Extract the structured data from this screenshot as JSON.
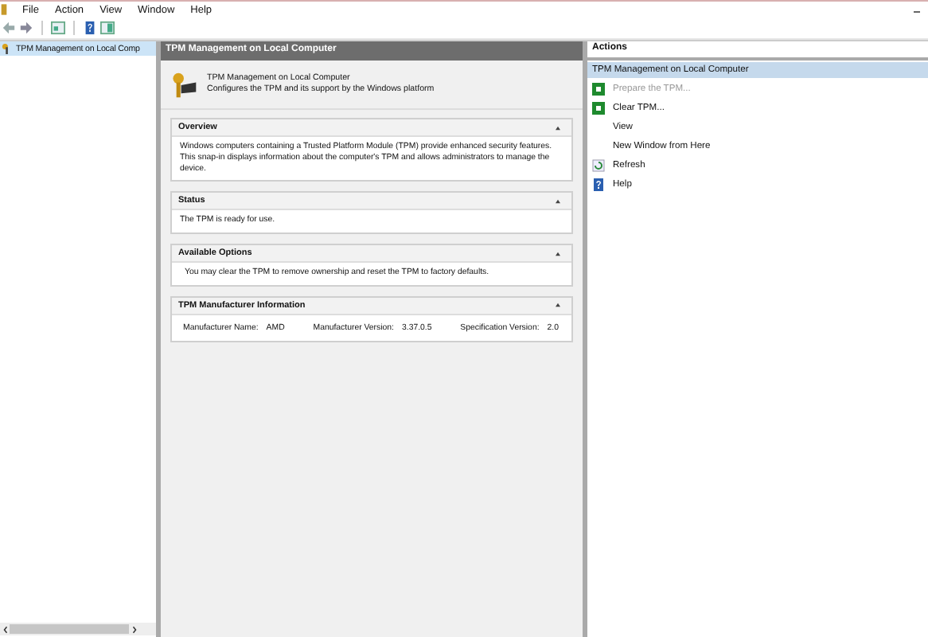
{
  "menu": [
    "File",
    "Action",
    "View",
    "Window",
    "Help"
  ],
  "tree": {
    "items": [
      {
        "label": "TPM Management on Local Comp",
        "selected": true
      }
    ]
  },
  "center": {
    "title": "TPM Management on Local Computer",
    "header": {
      "title": "TPM Management on Local Computer",
      "subtitle": "Configures the TPM and its support by the Windows platform"
    },
    "sections": [
      {
        "title": "Overview",
        "kind": "text",
        "text": "Windows computers containing a Trusted Platform Module (TPM) provide enhanced security features. This snap-in displays information about the computer's TPM and allows administrators to manage the device."
      },
      {
        "title": "Status",
        "kind": "text",
        "text": "The TPM is ready for use."
      },
      {
        "title": "Available Options",
        "kind": "text",
        "text": "You may clear the TPM to remove ownership and reset the TPM to factory defaults."
      },
      {
        "title": "TPM Manufacturer Information",
        "kind": "fields",
        "fields": [
          {
            "label": "Manufacturer Name:",
            "value": "AMD"
          },
          {
            "label": "Manufacturer Version:",
            "value": "3.37.0.5"
          },
          {
            "label": "Specification Version:",
            "value": "2.0"
          }
        ]
      }
    ]
  },
  "actions": {
    "title": "Actions",
    "group": "TPM Management on Local Computer",
    "items": [
      {
        "label": "Prepare the TPM...",
        "kind": "task",
        "disabled": true
      },
      {
        "label": "Clear TPM...",
        "kind": "task",
        "disabled": false
      },
      {
        "label": "View",
        "kind": "plain",
        "disabled": false
      },
      {
        "label": "New Window from Here",
        "kind": "plain",
        "disabled": false
      },
      {
        "label": "Refresh",
        "kind": "refresh",
        "disabled": false
      },
      {
        "label": "Help",
        "kind": "help",
        "disabled": false
      }
    ]
  }
}
